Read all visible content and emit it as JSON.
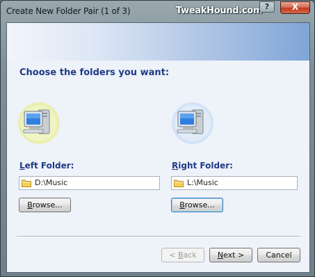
{
  "window": {
    "title": "Create New Folder Pair (1 of 3)",
    "watermark": "TweakHound.com",
    "help_label": "?",
    "close_label": "X"
  },
  "wizard": {
    "heading": "Choose the folders you want:"
  },
  "left": {
    "label_accel": "L",
    "label_rest": "eft Folder:",
    "path": "D:\\Music",
    "browse_accel": "B",
    "browse_rest": "rowse..."
  },
  "right": {
    "label_accel": "R",
    "label_rest": "ight Folder:",
    "path": "L:\\Music",
    "browse_accel": "B",
    "browse_rest": "rowse..."
  },
  "footer": {
    "back_pre": "< ",
    "back_accel": "B",
    "back_rest": "ack",
    "next_accel": "N",
    "next_rest": "ext >",
    "cancel_label": "Cancel"
  },
  "colors": {
    "heading": "#1f3b86",
    "banner_end": "#7fa5d8",
    "close_red": "#c03a1e"
  },
  "icons": {
    "left_computer": "computer-icon",
    "right_computer": "computer-icon",
    "folder": "folder-icon"
  }
}
